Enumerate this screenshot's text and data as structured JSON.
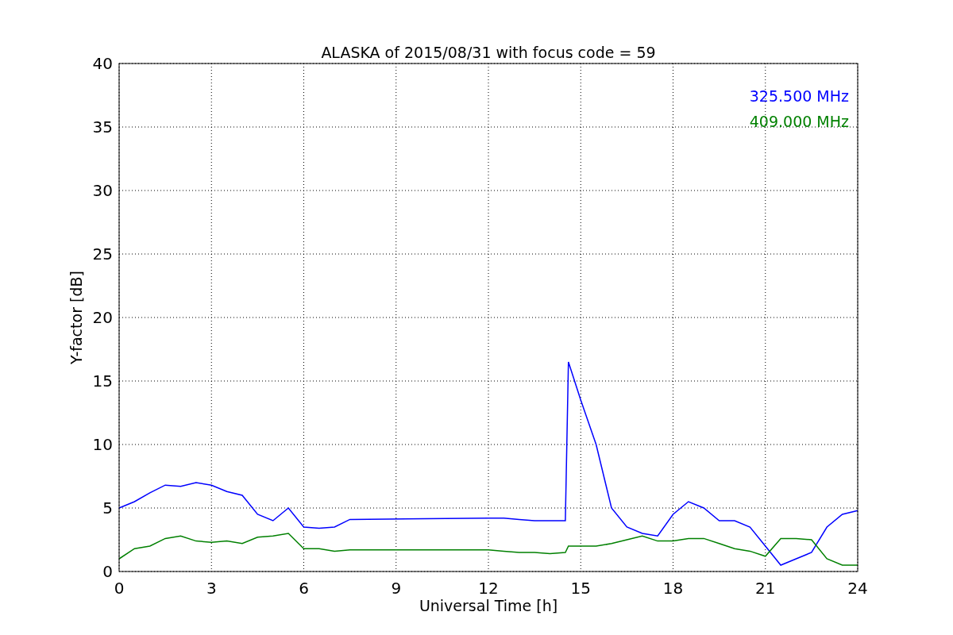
{
  "chart": {
    "chart_data": {
      "type": "line",
      "title": "ALASKA of 2015/08/31 with focus code = 59",
      "xlabel": "Universal Time [h]",
      "ylabel": "Y-factor [dB]",
      "x": [
        0,
        0.5,
        1,
        1.5,
        2,
        2.5,
        3,
        3.5,
        4,
        4.5,
        5,
        5.5,
        6,
        6.5,
        7,
        7.5,
        12,
        12.5,
        13,
        13.5,
        14,
        14.5,
        14.6,
        15,
        15.5,
        16,
        16.5,
        17,
        17.5,
        18,
        18.5,
        19,
        19.5,
        20,
        20.5,
        21,
        21.5,
        22,
        22.5,
        23,
        23.5,
        24
      ],
      "series": [
        {
          "name": "325.500 MHz",
          "color": "#0000ff",
          "values": [
            5,
            5.5,
            6.2,
            6.8,
            6.7,
            7.0,
            6.8,
            6.3,
            6.0,
            4.5,
            4.0,
            5.0,
            3.5,
            3.4,
            3.5,
            4.1,
            4.2,
            4.2,
            4.1,
            4.0,
            4.0,
            4.0,
            16.5,
            13.5,
            10,
            5,
            3.5,
            3,
            2.8,
            4.5,
            5.5,
            5.0,
            4,
            4,
            3.5,
            2,
            0.5,
            1.0,
            1.5,
            3.5,
            4.5,
            4.8
          ]
        },
        {
          "name": "409.000 MHz",
          "color": "#008000",
          "values": [
            1.0,
            1.8,
            2.0,
            2.6,
            2.8,
            2.4,
            2.3,
            2.4,
            2.2,
            2.7,
            2.8,
            3.0,
            1.8,
            1.8,
            1.6,
            1.7,
            1.7,
            1.6,
            1.5,
            1.5,
            1.4,
            1.5,
            2.0,
            2.0,
            2.0,
            2.2,
            2.5,
            2.8,
            2.4,
            2.4,
            2.6,
            2.6,
            2.2,
            1.8,
            1.6,
            1.2,
            2.6,
            2.6,
            2.5,
            1.0,
            0.5,
            0.5
          ]
        }
      ],
      "xlim": [
        0,
        24
      ],
      "ylim": [
        0,
        40
      ],
      "xticks": [
        0,
        3,
        6,
        9,
        12,
        15,
        18,
        21,
        24
      ],
      "yticks": [
        0,
        5,
        10,
        15,
        20,
        25,
        30,
        35,
        40
      ],
      "grid": true
    }
  }
}
